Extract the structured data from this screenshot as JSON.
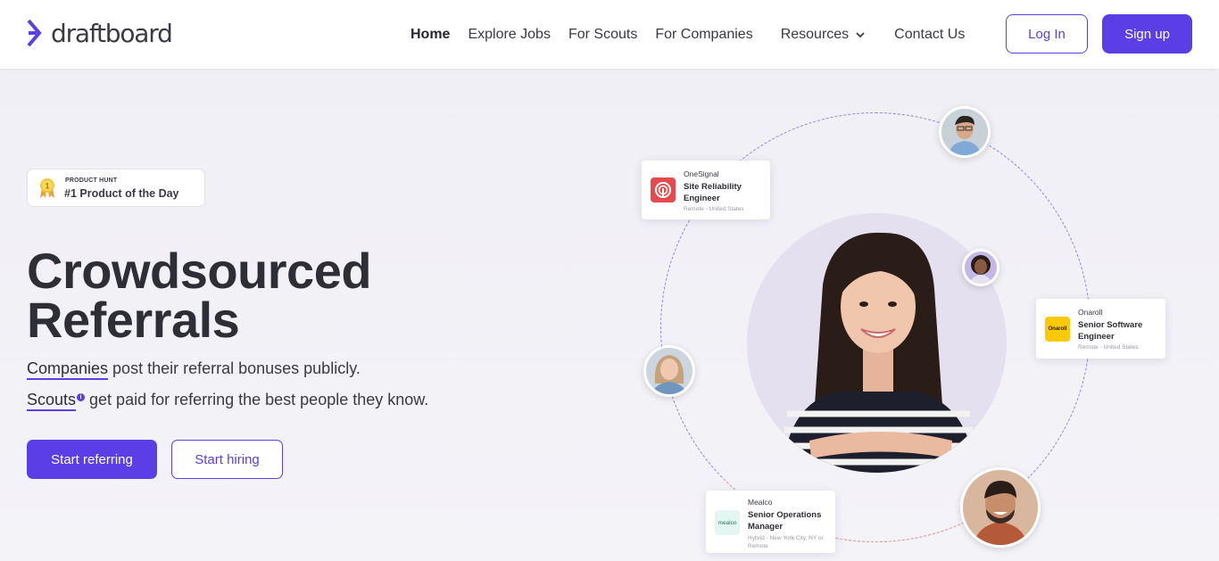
{
  "header": {
    "logo_text": "draftboard",
    "nav": {
      "home": "Home",
      "explore_jobs": "Explore Jobs",
      "for_scouts": "For Scouts",
      "for_companies": "For Companies",
      "resources": "Resources",
      "contact_us": "Contact Us"
    },
    "login_label": "Log In",
    "signup_label": "Sign up"
  },
  "badge": {
    "small_label": "PRODUCT HUNT",
    "title": "#1 Product of the Day",
    "medal_number": "1"
  },
  "hero": {
    "headline_line1": "Crowdsourced",
    "headline_line2": "Referrals",
    "line1_link": "Companies",
    "line1_rest": " post their referral bonuses publicly.",
    "line2_link": "Scouts",
    "line2_info": "i",
    "line2_rest": " get paid for referring the best people they know.",
    "start_referring": "Start referring",
    "start_hiring": "Start hiring"
  },
  "job_cards": [
    {
      "company": "OneSignal",
      "title": "Site Reliability Engineer",
      "location": "Remote - United States",
      "logo_color": "#e54b4d"
    },
    {
      "company": "Onaroll",
      "title": "Senior Software Engineer",
      "location": "Remote - United States",
      "logo_text": "Onaroll",
      "logo_color": "#ffc900"
    },
    {
      "company": "Mealco",
      "title": "Senior Operations Manager",
      "location": "Hybrid - New York City, NY or Remote",
      "logo_text": "mealco",
      "logo_color": "#e4f6f2"
    }
  ],
  "colors": {
    "accent": "#5b3ee6",
    "ring": "#8f86d8"
  }
}
